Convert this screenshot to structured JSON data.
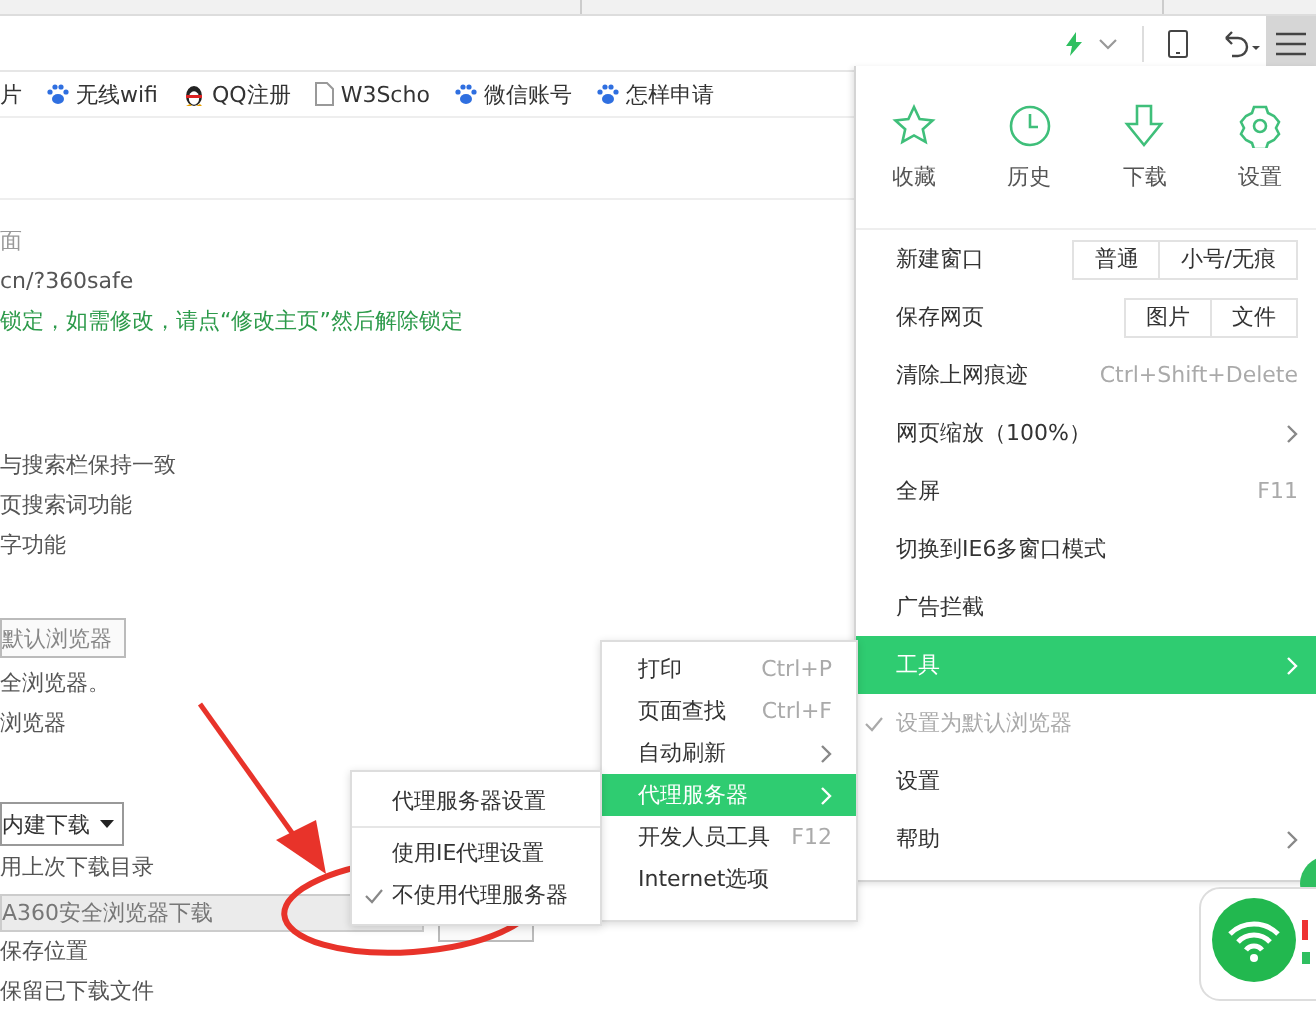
{
  "toolbar": {
    "menu_button": {
      "selected": true
    }
  },
  "bookmarks": [
    {
      "label": "片",
      "kind": "none"
    },
    {
      "label": "无线wifi",
      "kind": "paw"
    },
    {
      "label": "QQ注册",
      "kind": "penguin"
    },
    {
      "label": "W3Scho",
      "kind": "page"
    },
    {
      "label": "微信账号",
      "kind": "paw"
    },
    {
      "label": "怎样申请",
      "kind": "paw"
    }
  ],
  "page": {
    "sections": [
      {
        "lines": [
          {
            "kind": "label",
            "text": "面"
          },
          {
            "kind": "text",
            "text": "cn/?360safe"
          },
          {
            "kind": "notice",
            "text": "锁定，如需修改，请点“修改主页”然后解除锁定"
          }
        ]
      },
      {
        "lines": [
          {
            "kind": "text",
            "text": "与搜索栏保持一致"
          },
          {
            "kind": "text",
            "text": "页搜索词功能"
          },
          {
            "kind": "text",
            "text": "字功能"
          }
        ]
      },
      {
        "lines": [
          {
            "kind": "button",
            "text": "默认浏览器"
          },
          {
            "kind": "text",
            "text": "全浏览器。"
          },
          {
            "kind": "text",
            "text": "浏览器"
          }
        ]
      },
      {
        "lines": [
          {
            "kind": "dropdown",
            "text": "内建下载"
          },
          {
            "kind": "text",
            "text": "用上次下载目录"
          },
          {
            "kind": "field",
            "text": "A360安全浏览器下载"
          },
          {
            "kind": "text",
            "text": "保存位置"
          },
          {
            "kind": "text",
            "text": "保留已下载文件"
          }
        ]
      }
    ]
  },
  "main_menu": {
    "shortcuts": [
      {
        "label": "收藏",
        "kind": "favorites"
      },
      {
        "label": "历史",
        "kind": "history"
      },
      {
        "label": "下载",
        "kind": "downloads"
      },
      {
        "label": "设置",
        "kind": "settings"
      }
    ],
    "items": [
      {
        "label": "新建窗口",
        "kind": "buttons",
        "buttons": [
          "普通",
          "小号/无痕"
        ],
        "selected": false,
        "checked": false,
        "disabled": false
      },
      {
        "label": "保存网页",
        "kind": "buttons",
        "buttons": [
          "图片",
          "文件"
        ],
        "selected": false,
        "checked": false,
        "disabled": false
      },
      {
        "label": "清除上网痕迹",
        "kind": "shortcut",
        "shortcut": "Ctrl+Shift+Delete",
        "selected": false,
        "checked": false,
        "disabled": false
      },
      {
        "label": "网页缩放（100%）",
        "kind": "submenu",
        "selected": false,
        "checked": false,
        "disabled": false
      },
      {
        "label": "全屏",
        "kind": "shortcut",
        "shortcut": "F11",
        "selected": false,
        "checked": false,
        "disabled": false
      },
      {
        "label": "切换到IE6多窗口模式",
        "kind": "plain",
        "selected": false,
        "checked": false,
        "disabled": false
      },
      {
        "label": "广告拦截",
        "kind": "plain",
        "selected": false,
        "checked": false,
        "disabled": false
      },
      {
        "label": "工具",
        "kind": "submenu",
        "selected": true,
        "checked": false,
        "disabled": false
      },
      {
        "label": "设置为默认浏览器",
        "kind": "plain",
        "selected": false,
        "checked": true,
        "disabled": true
      },
      {
        "label": "设置",
        "kind": "plain",
        "selected": false,
        "checked": false,
        "disabled": false
      },
      {
        "label": "帮助",
        "kind": "submenu",
        "selected": false,
        "checked": false,
        "disabled": false
      }
    ]
  },
  "tools_menu": {
    "items": [
      {
        "label": "打印",
        "kind": "shortcut",
        "shortcut": "Ctrl+P",
        "selected": false
      },
      {
        "label": "页面查找",
        "kind": "shortcut",
        "shortcut": "Ctrl+F",
        "selected": false
      },
      {
        "label": "自动刷新",
        "kind": "submenu",
        "selected": false
      },
      {
        "label": "代理服务器",
        "kind": "submenu",
        "selected": true
      },
      {
        "label": "开发人员工具",
        "kind": "shortcut",
        "shortcut": "F12",
        "selected": false
      },
      {
        "label": "Internet选项",
        "kind": "plain",
        "selected": false
      }
    ]
  },
  "proxy_menu": {
    "groups": [
      {
        "items": [
          {
            "label": "代理服务器设置",
            "checked": false
          }
        ]
      },
      {
        "items": [
          {
            "label": "使用IE代理设置",
            "checked": false
          },
          {
            "label": "不使用代理服务器",
            "checked": true
          }
        ]
      }
    ]
  }
}
